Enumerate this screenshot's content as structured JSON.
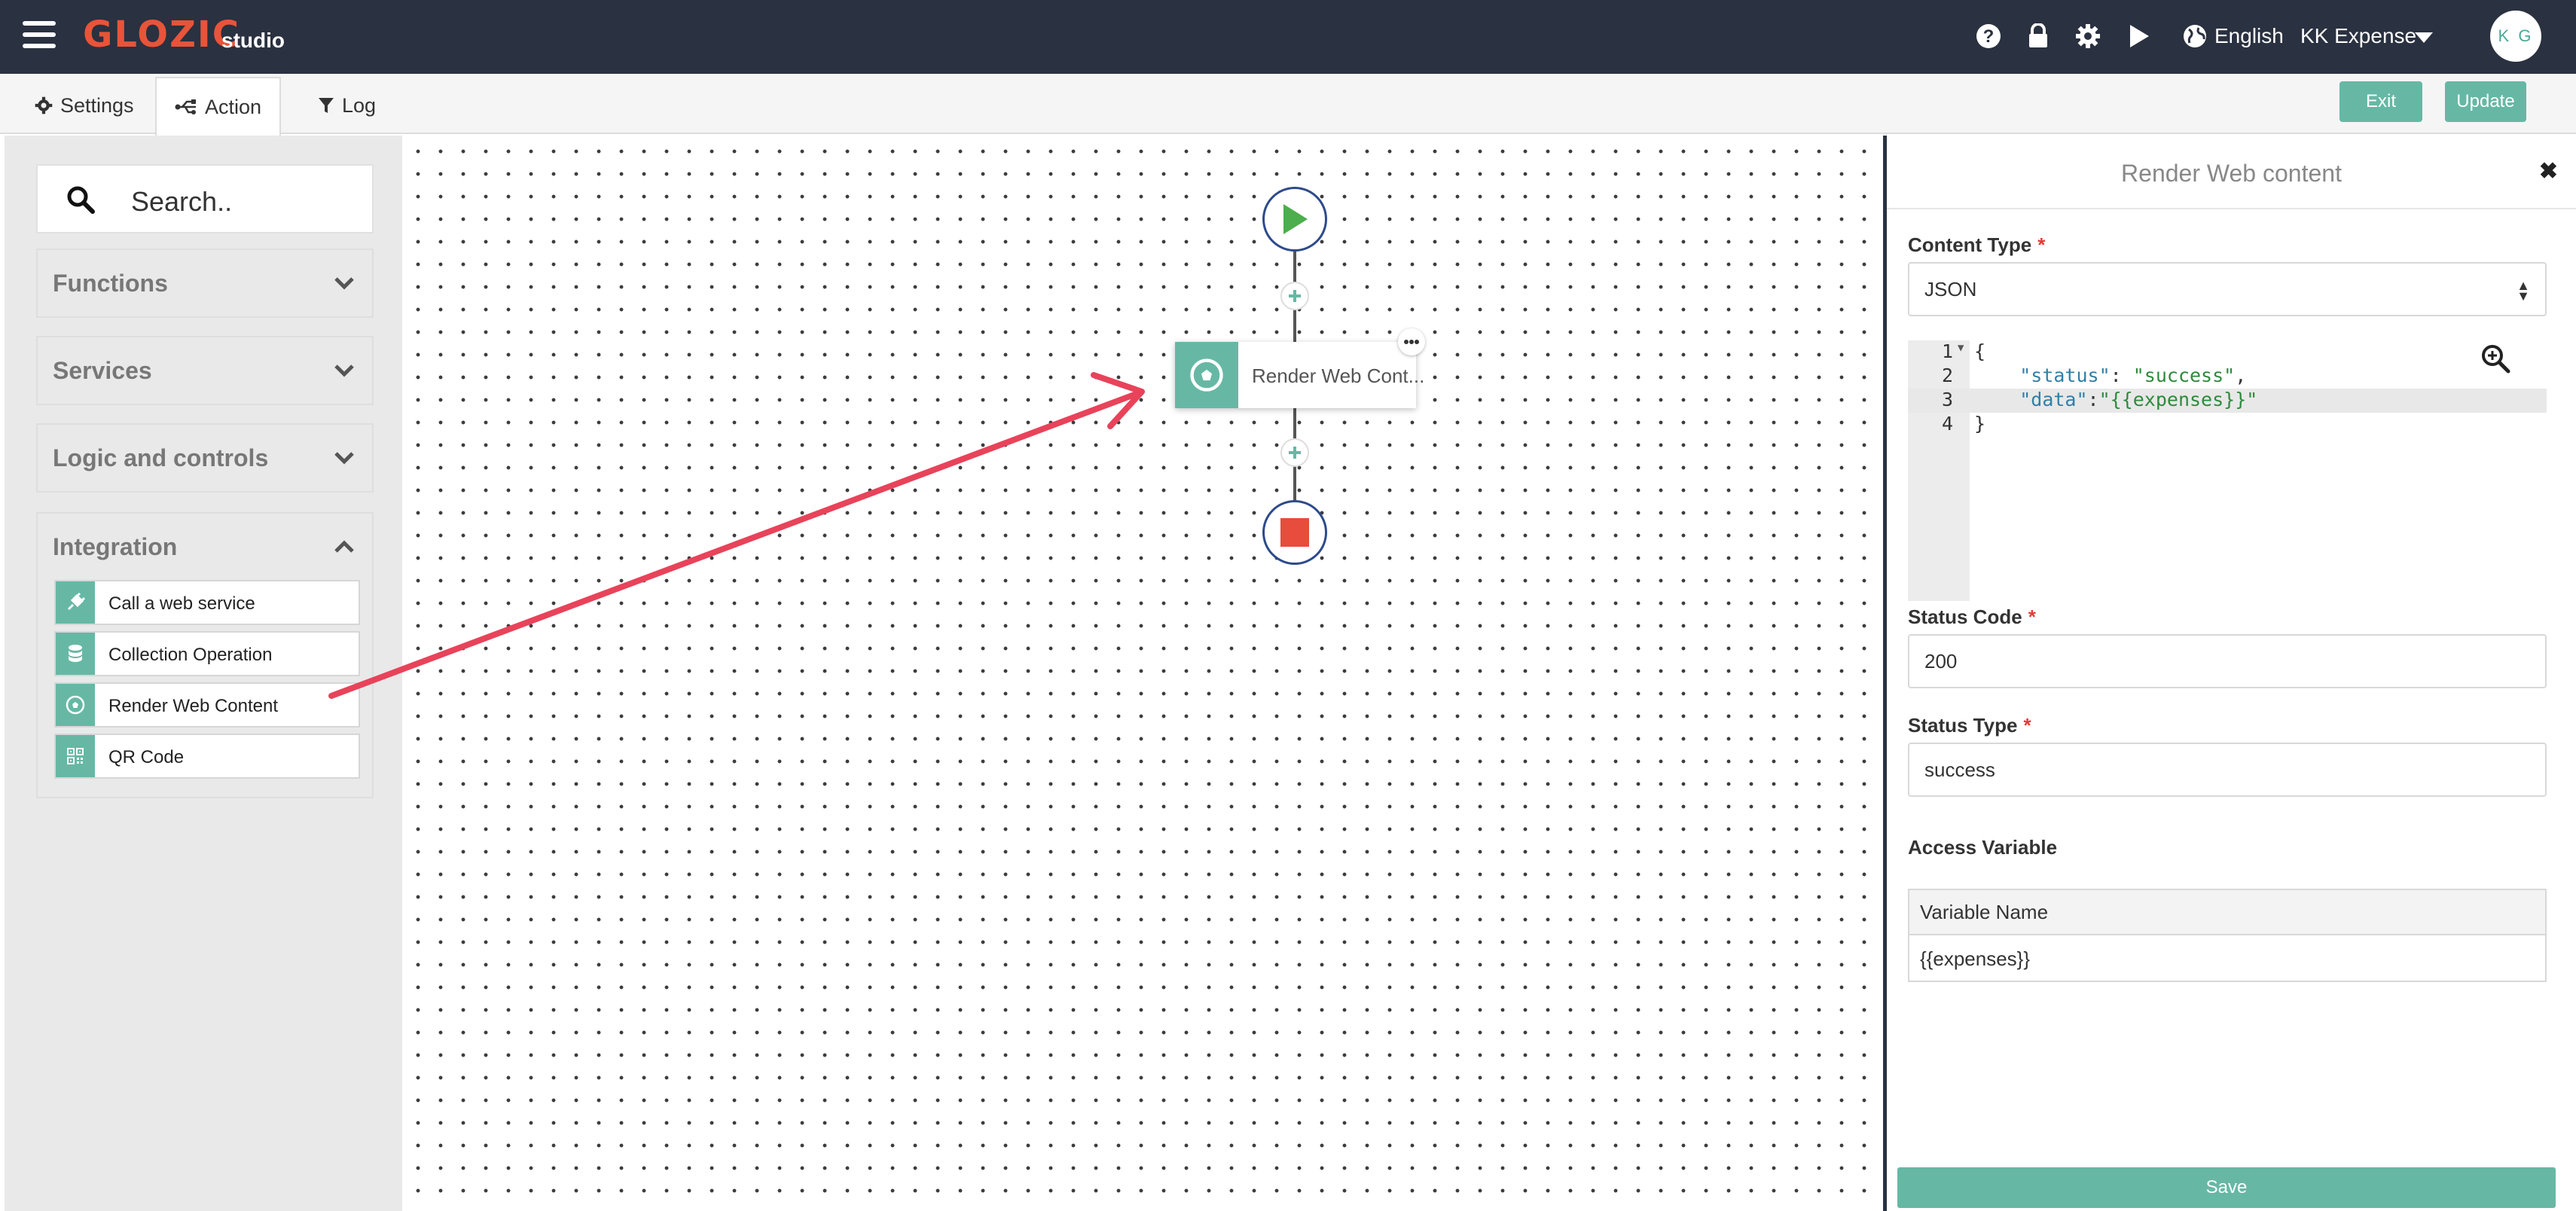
{
  "app": {
    "logo": "GLOZIC",
    "logo_sub": "studio"
  },
  "header": {
    "language": "English",
    "workspace": "KK Expense",
    "avatar_initials": "K G",
    "icons": [
      "help-icon",
      "lock-icon",
      "gear-icon",
      "play-icon",
      "globe-icon",
      "caret-down-icon"
    ]
  },
  "tabs": [
    {
      "label": "Settings",
      "icon": "gear-icon"
    },
    {
      "label": "Action",
      "icon": "usb-icon",
      "active": true
    },
    {
      "label": "Log",
      "icon": "filter-icon"
    }
  ],
  "toolbar": {
    "exit_label": "Exit",
    "update_label": "Update"
  },
  "sidebar": {
    "search_placeholder": "Search..",
    "groups": [
      {
        "label": "Functions",
        "expanded": false
      },
      {
        "label": "Services",
        "expanded": false
      },
      {
        "label": "Logic and controls",
        "expanded": false
      },
      {
        "label": "Integration",
        "expanded": true
      }
    ],
    "integration_items": [
      {
        "label": "Call a web service",
        "icon": "plug-icon"
      },
      {
        "label": "Collection Operation",
        "icon": "database-icon"
      },
      {
        "label": "Render Web Content",
        "icon": "soccer-ball-icon"
      },
      {
        "label": "QR Code",
        "icon": "qrcode-icon"
      }
    ]
  },
  "flow": {
    "node_label": "Render Web Cont...",
    "node_icon": "soccer-ball-icon",
    "start_icon": "play-icon",
    "stop_icon": "stop-icon",
    "annotation_arrow_color": "#e8435a"
  },
  "panel": {
    "title": "Render Web content",
    "content_type_label": "Content Type",
    "content_type_value": "JSON",
    "code_lines": [
      {
        "n": "1",
        "text": "{"
      },
      {
        "n": "2",
        "key": "\"status\"",
        "sep": ": ",
        "val": "\"success\"",
        "end": ","
      },
      {
        "n": "3",
        "key": "\"data\"",
        "sep": ":",
        "val": "\"{{expenses}}\"",
        "end": ""
      },
      {
        "n": "4",
        "text": "}"
      }
    ],
    "status_code_label": "Status Code",
    "status_code_value": "200",
    "status_type_label": "Status Type",
    "status_type_value": "success",
    "access_variable_label": "Access Variable",
    "variable_header": "Variable Name",
    "variable_value": "{{expenses}}",
    "save_label": "Save"
  },
  "colors": {
    "navbar": "#2a3140",
    "accent": "#66b8a5",
    "logo": "#e8543a",
    "required": "#e53935",
    "stop": "#e74c3c",
    "start": "#4cae4c"
  }
}
